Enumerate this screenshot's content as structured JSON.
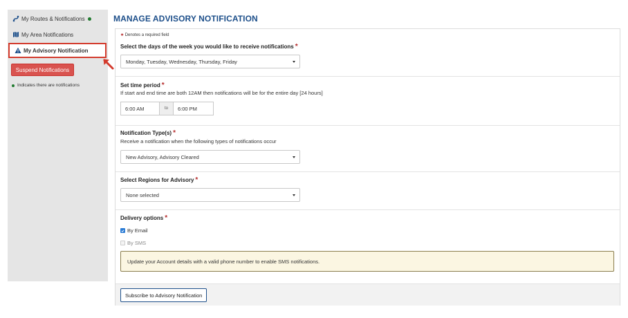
{
  "sidebar": {
    "items": [
      {
        "label": "My Routes & Notifications",
        "icon": "route-icon",
        "has_notifications": true
      },
      {
        "label": "My Area Notifications",
        "icon": "map-icon",
        "has_notifications": false
      },
      {
        "label": "My Advisory Notification",
        "icon": "warning-icon",
        "has_notifications": false,
        "active": true
      }
    ],
    "suspend_label": "Suspend Notifications",
    "legend_text": "Indicates there are notifications"
  },
  "main": {
    "title": "MANAGE ADVISORY NOTIFICATION",
    "required_note": "Denotes a required field",
    "days": {
      "label": "Select the days of the week you would like to receive notifications",
      "value": "Monday, Tuesday, Wednesday, Thursday, Friday"
    },
    "time": {
      "label": "Set time period",
      "help": "If start and end time are both 12AM then notifications will be for the entire day [24 hours]",
      "start": "6:00 AM",
      "to": "to",
      "end": "6:00 PM"
    },
    "types": {
      "label": "Notification Type(s)",
      "help": "Receive a notification when the following types of notifications occur",
      "value": "New Advisory, Advisory Cleared"
    },
    "regions": {
      "label": "Select Regions for Advisory",
      "value": "None selected"
    },
    "delivery": {
      "label": "Delivery options",
      "email_label": "By Email",
      "email_checked": true,
      "sms_label": "By SMS",
      "sms_checked": false,
      "notice": "Update your Account details with a valid phone number to enable SMS notifications."
    },
    "subscribe_label": "Subscribe to Advisory Notification"
  },
  "colors": {
    "title": "#1d4f8a",
    "active_border": "#d33a2c",
    "suspend_bg": "#d9534f",
    "notification_dot": "#1f7a2e",
    "required_star": "#b52b2b",
    "notice_bg": "#fbf6e2"
  }
}
